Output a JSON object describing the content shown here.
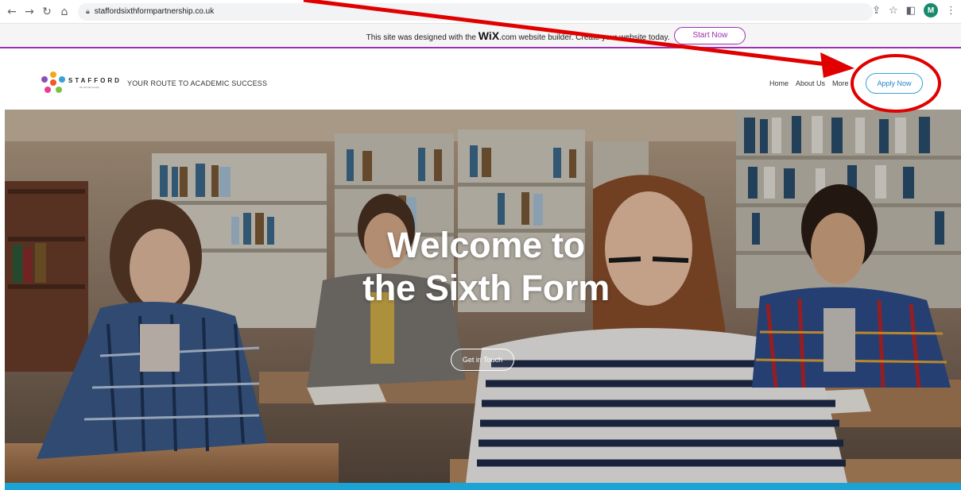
{
  "browser": {
    "url": "staffordsixthformpartnership.co.uk",
    "profile_initial": "M",
    "icons": [
      "back-arrow-icon",
      "forward-arrow-icon",
      "reload-icon",
      "home-icon",
      "lock-icon",
      "share-icon",
      "star-icon",
      "sidepanel-icon",
      "menu-icon"
    ]
  },
  "wix_banner": {
    "text_before": "This site was designed with the ",
    "logo": "WiX",
    "logo_suffix": ".com",
    "text_after": " website builder. Create your website today.",
    "button": "Start Now"
  },
  "header": {
    "logo_name": "STAFFORD",
    "logo_sub": "6th SF Partnership",
    "tagline": "YOUR ROUTE TO ACADEMIC SUCCESS",
    "nav": [
      "Home",
      "About Us",
      "More"
    ],
    "apply_button": "Apply Now"
  },
  "hero": {
    "title_line1": "Welcome to",
    "title_line2": "the Sixth Form",
    "cta": "Get in Touch"
  },
  "colors": {
    "wix_accent": "#9b30b0",
    "apply_border": "#3aa0d8",
    "strip": "#1ca3d6",
    "annotation": "#e00000"
  }
}
